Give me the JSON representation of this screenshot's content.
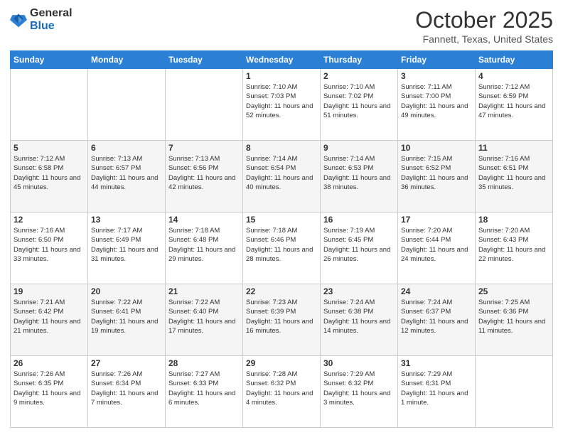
{
  "logo": {
    "general": "General",
    "blue": "Blue"
  },
  "header": {
    "month": "October 2025",
    "location": "Fannett, Texas, United States"
  },
  "weekdays": [
    "Sunday",
    "Monday",
    "Tuesday",
    "Wednesday",
    "Thursday",
    "Friday",
    "Saturday"
  ],
  "weeks": [
    [
      {
        "day": "",
        "info": ""
      },
      {
        "day": "",
        "info": ""
      },
      {
        "day": "",
        "info": ""
      },
      {
        "day": "1",
        "info": "Sunrise: 7:10 AM\nSunset: 7:03 PM\nDaylight: 11 hours and 52 minutes."
      },
      {
        "day": "2",
        "info": "Sunrise: 7:10 AM\nSunset: 7:02 PM\nDaylight: 11 hours and 51 minutes."
      },
      {
        "day": "3",
        "info": "Sunrise: 7:11 AM\nSunset: 7:00 PM\nDaylight: 11 hours and 49 minutes."
      },
      {
        "day": "4",
        "info": "Sunrise: 7:12 AM\nSunset: 6:59 PM\nDaylight: 11 hours and 47 minutes."
      }
    ],
    [
      {
        "day": "5",
        "info": "Sunrise: 7:12 AM\nSunset: 6:58 PM\nDaylight: 11 hours and 45 minutes."
      },
      {
        "day": "6",
        "info": "Sunrise: 7:13 AM\nSunset: 6:57 PM\nDaylight: 11 hours and 44 minutes."
      },
      {
        "day": "7",
        "info": "Sunrise: 7:13 AM\nSunset: 6:56 PM\nDaylight: 11 hours and 42 minutes."
      },
      {
        "day": "8",
        "info": "Sunrise: 7:14 AM\nSunset: 6:54 PM\nDaylight: 11 hours and 40 minutes."
      },
      {
        "day": "9",
        "info": "Sunrise: 7:14 AM\nSunset: 6:53 PM\nDaylight: 11 hours and 38 minutes."
      },
      {
        "day": "10",
        "info": "Sunrise: 7:15 AM\nSunset: 6:52 PM\nDaylight: 11 hours and 36 minutes."
      },
      {
        "day": "11",
        "info": "Sunrise: 7:16 AM\nSunset: 6:51 PM\nDaylight: 11 hours and 35 minutes."
      }
    ],
    [
      {
        "day": "12",
        "info": "Sunrise: 7:16 AM\nSunset: 6:50 PM\nDaylight: 11 hours and 33 minutes."
      },
      {
        "day": "13",
        "info": "Sunrise: 7:17 AM\nSunset: 6:49 PM\nDaylight: 11 hours and 31 minutes."
      },
      {
        "day": "14",
        "info": "Sunrise: 7:18 AM\nSunset: 6:48 PM\nDaylight: 11 hours and 29 minutes."
      },
      {
        "day": "15",
        "info": "Sunrise: 7:18 AM\nSunset: 6:46 PM\nDaylight: 11 hours and 28 minutes."
      },
      {
        "day": "16",
        "info": "Sunrise: 7:19 AM\nSunset: 6:45 PM\nDaylight: 11 hours and 26 minutes."
      },
      {
        "day": "17",
        "info": "Sunrise: 7:20 AM\nSunset: 6:44 PM\nDaylight: 11 hours and 24 minutes."
      },
      {
        "day": "18",
        "info": "Sunrise: 7:20 AM\nSunset: 6:43 PM\nDaylight: 11 hours and 22 minutes."
      }
    ],
    [
      {
        "day": "19",
        "info": "Sunrise: 7:21 AM\nSunset: 6:42 PM\nDaylight: 11 hours and 21 minutes."
      },
      {
        "day": "20",
        "info": "Sunrise: 7:22 AM\nSunset: 6:41 PM\nDaylight: 11 hours and 19 minutes."
      },
      {
        "day": "21",
        "info": "Sunrise: 7:22 AM\nSunset: 6:40 PM\nDaylight: 11 hours and 17 minutes."
      },
      {
        "day": "22",
        "info": "Sunrise: 7:23 AM\nSunset: 6:39 PM\nDaylight: 11 hours and 16 minutes."
      },
      {
        "day": "23",
        "info": "Sunrise: 7:24 AM\nSunset: 6:38 PM\nDaylight: 11 hours and 14 minutes."
      },
      {
        "day": "24",
        "info": "Sunrise: 7:24 AM\nSunset: 6:37 PM\nDaylight: 11 hours and 12 minutes."
      },
      {
        "day": "25",
        "info": "Sunrise: 7:25 AM\nSunset: 6:36 PM\nDaylight: 11 hours and 11 minutes."
      }
    ],
    [
      {
        "day": "26",
        "info": "Sunrise: 7:26 AM\nSunset: 6:35 PM\nDaylight: 11 hours and 9 minutes."
      },
      {
        "day": "27",
        "info": "Sunrise: 7:26 AM\nSunset: 6:34 PM\nDaylight: 11 hours and 7 minutes."
      },
      {
        "day": "28",
        "info": "Sunrise: 7:27 AM\nSunset: 6:33 PM\nDaylight: 11 hours and 6 minutes."
      },
      {
        "day": "29",
        "info": "Sunrise: 7:28 AM\nSunset: 6:32 PM\nDaylight: 11 hours and 4 minutes."
      },
      {
        "day": "30",
        "info": "Sunrise: 7:29 AM\nSunset: 6:32 PM\nDaylight: 11 hours and 3 minutes."
      },
      {
        "day": "31",
        "info": "Sunrise: 7:29 AM\nSunset: 6:31 PM\nDaylight: 11 hours and 1 minute."
      },
      {
        "day": "",
        "info": ""
      }
    ]
  ]
}
